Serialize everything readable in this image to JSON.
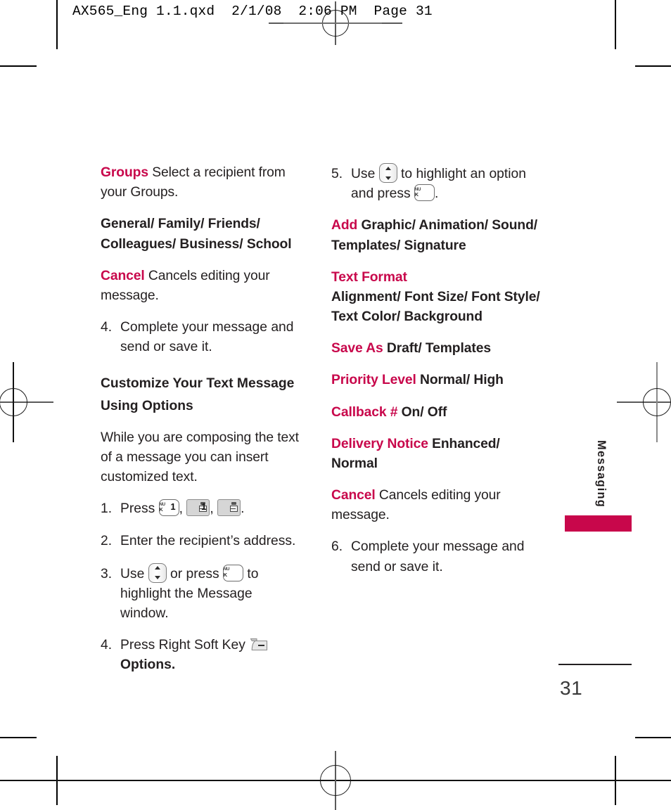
{
  "accent_color": "#C8074B",
  "header": {
    "file_info": "AX565_Eng 1.1.qxd  2/1/08  2:06 PM  Page 31"
  },
  "side_tab": {
    "label": "Messaging"
  },
  "page_number": "31",
  "left_column": {
    "groups_entry": {
      "term": "Groups",
      "description": "Select a recipient from your Groups."
    },
    "groups_options": "General/ Family/ Friends/ Colleagues/ Business/ School",
    "cancel_entry": {
      "term": "Cancel",
      "description": "Cancels editing your message."
    },
    "step4": {
      "num": "4.",
      "text": "Complete your message and send or save it."
    },
    "section_heading": "Customize Your Text Message Using Options",
    "intro": "While you are composing the text of a message you can insert customized text.",
    "step1": {
      "num": "1.",
      "text_before": "Press",
      "comma1": ",",
      "comma2": ",",
      "period": "."
    },
    "step2": {
      "num": "2.",
      "text": "Enter the recipient’s address."
    },
    "step3": {
      "num": "3.",
      "text_before": "Use",
      "text_middle": "or press",
      "text_after": "to highlight the Message window."
    },
    "step4b": {
      "num": "4.",
      "text_before": "Press Right Soft Key",
      "text_after": "Options."
    }
  },
  "right_column": {
    "step5": {
      "num": "5.",
      "text_before": "Use",
      "text_middle": "to highlight an option and press",
      "text_after": "."
    },
    "add_entry": {
      "term": "Add",
      "options": "Graphic/ Animation/ Sound/ Templates/ Signature"
    },
    "text_format_entry": {
      "term": "Text Format",
      "options": "Alignment/ Font Size/ Font Style/ Text Color/ Background"
    },
    "save_as_entry": {
      "term": "Save As",
      "options": "Draft/ Templates"
    },
    "priority_level_entry": {
      "term": "Priority Level",
      "options": "Normal/ High"
    },
    "callback_entry": {
      "term": "Callback #",
      "options": "On/ Off"
    },
    "delivery_notice_entry": {
      "term": "Delivery Notice",
      "options": "Enhanced/ Normal"
    },
    "cancel_entry": {
      "term": "Cancel",
      "description": "Cancels editing your message."
    },
    "step6": {
      "num": "6.",
      "text": "Complete your message and send or save it."
    }
  },
  "icons": {
    "menu_ok_key": {
      "name": "menu-ok-key",
      "line1": "MENU",
      "line2": "OK"
    },
    "number_one_key": {
      "name": "number-1-key",
      "digit": "1"
    },
    "nav_key": {
      "name": "navigation-up-down-key"
    },
    "right_soft_key": {
      "name": "right-soft-key"
    }
  }
}
